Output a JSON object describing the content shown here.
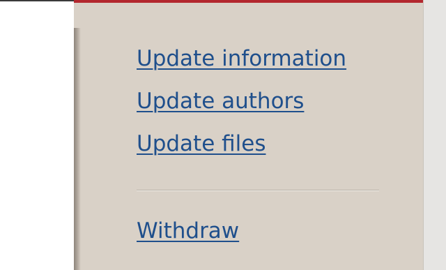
{
  "menu": {
    "items": [
      {
        "label": "Update information"
      },
      {
        "label": "Update authors"
      },
      {
        "label": "Update files"
      }
    ],
    "withdraw_label": "Withdraw"
  },
  "colors": {
    "panel_background": "#d9d1c7",
    "accent_bar": "#b3272e",
    "link": "#1f4f8c"
  }
}
